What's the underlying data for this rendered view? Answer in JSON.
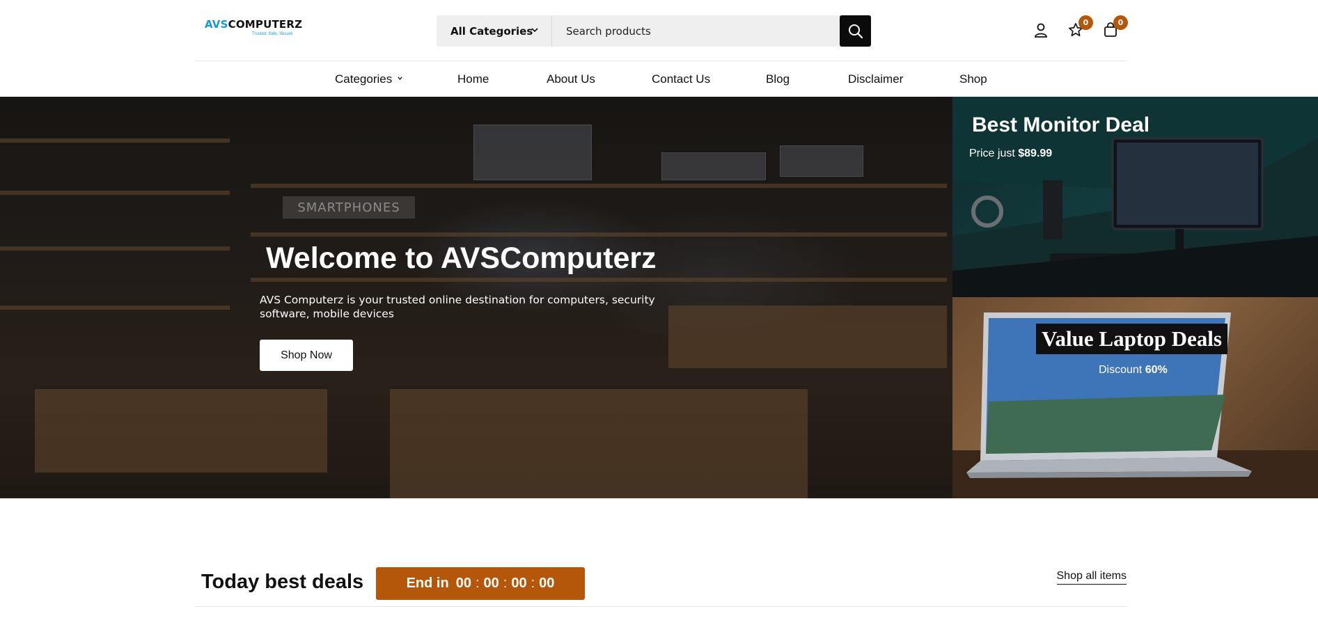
{
  "header": {
    "logo": {
      "part1": "AVS",
      "part2": "COMPUTERZ",
      "tagline": "Trusted, Safe, Secure"
    },
    "search": {
      "category_label": "All Categories",
      "placeholder": "Search products"
    },
    "wishlist_count": "0",
    "cart_count": "0"
  },
  "nav": {
    "items": [
      "Categories",
      "Home",
      "About Us",
      "Contact Us",
      "Blog",
      "Disclaimer",
      "Shop"
    ]
  },
  "hero": {
    "sign": "SMARTPHONES",
    "title": "Welcome to AVSComputerz",
    "description": "AVS Computerz is your trusted online destination for computers, security software, mobile devices",
    "button": "Shop Now"
  },
  "promos": {
    "monitor": {
      "title": "Best Monitor Deal",
      "price_prefix": "Price just ",
      "price": "$89.99"
    },
    "laptop": {
      "title": "Value Laptop Deals",
      "discount_prefix": "Discount ",
      "discount": "60%"
    }
  },
  "deals": {
    "title": "Today best deals",
    "countdown_label": "End in",
    "countdown": [
      "00",
      "00",
      "00",
      "00"
    ],
    "shop_all": "Shop all items"
  },
  "colors": {
    "accent": "#b4570a",
    "logo_blue": "#1496e0",
    "search_button": "#0b0b0b"
  },
  "icons": [
    "chevron-down-icon",
    "search-icon",
    "user-icon",
    "star-icon",
    "bag-icon"
  ]
}
